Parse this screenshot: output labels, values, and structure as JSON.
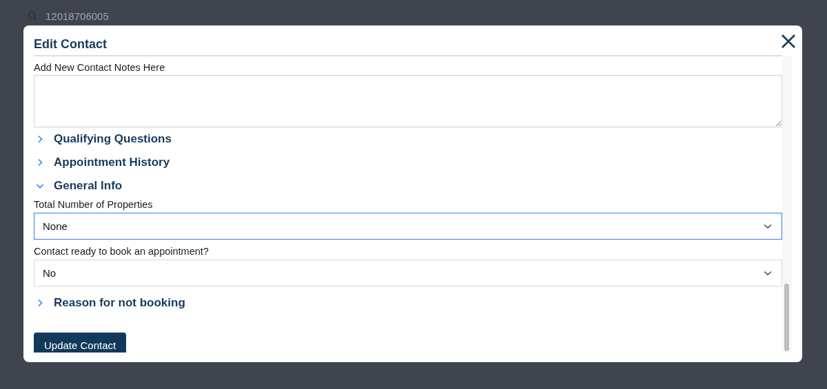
{
  "background": {
    "search_value": "12018706005"
  },
  "dialog": {
    "title": "Edit Contact"
  },
  "notes": {
    "label": "Add New Contact Notes Here"
  },
  "sections": [
    {
      "title": "Qualifying Questions",
      "expanded": false
    },
    {
      "title": "Appointment History",
      "expanded": false
    },
    {
      "title": "General Info",
      "expanded": true,
      "fields": [
        {
          "label": "Total Number of Properties",
          "value": "None",
          "focused": true
        },
        {
          "label": "Contact ready to book an appointment?",
          "value": "No",
          "focused": false
        }
      ]
    },
    {
      "title": "Reason for not booking",
      "expanded": false
    }
  ],
  "submit_button": "Update Contact"
}
